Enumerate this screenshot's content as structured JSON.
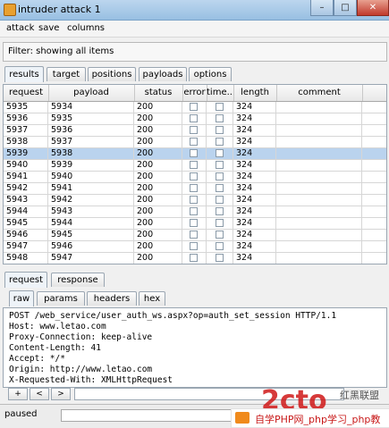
{
  "window": {
    "title": "intruder attack 1"
  },
  "menu": [
    "attack",
    "save",
    "columns"
  ],
  "filter": {
    "text": "Filter: showing all items"
  },
  "results_tabs": [
    "results",
    "target",
    "positions",
    "payloads",
    "options"
  ],
  "table": {
    "columns": [
      "request",
      "payload",
      "status",
      "error",
      "time...",
      "length",
      "comment"
    ],
    "rows": [
      {
        "request": "5935",
        "payload": "5934",
        "status": "200",
        "length": "324",
        "comment": ""
      },
      {
        "request": "5936",
        "payload": "5935",
        "status": "200",
        "length": "324",
        "comment": ""
      },
      {
        "request": "5937",
        "payload": "5936",
        "status": "200",
        "length": "324",
        "comment": ""
      },
      {
        "request": "5938",
        "payload": "5937",
        "status": "200",
        "length": "324",
        "comment": ""
      },
      {
        "request": "5939",
        "payload": "5938",
        "status": "200",
        "length": "324",
        "comment": "",
        "selected": true
      },
      {
        "request": "5940",
        "payload": "5939",
        "status": "200",
        "length": "324",
        "comment": ""
      },
      {
        "request": "5941",
        "payload": "5940",
        "status": "200",
        "length": "324",
        "comment": ""
      },
      {
        "request": "5942",
        "payload": "5941",
        "status": "200",
        "length": "324",
        "comment": ""
      },
      {
        "request": "5943",
        "payload": "5942",
        "status": "200",
        "length": "324",
        "comment": ""
      },
      {
        "request": "5944",
        "payload": "5943",
        "status": "200",
        "length": "324",
        "comment": ""
      },
      {
        "request": "5945",
        "payload": "5944",
        "status": "200",
        "length": "324",
        "comment": ""
      },
      {
        "request": "5946",
        "payload": "5945",
        "status": "200",
        "length": "324",
        "comment": ""
      },
      {
        "request": "5947",
        "payload": "5946",
        "status": "200",
        "length": "324",
        "comment": ""
      },
      {
        "request": "5948",
        "payload": "5947",
        "status": "200",
        "length": "324",
        "comment": ""
      }
    ]
  },
  "detail_tabs": [
    "request",
    "response"
  ],
  "view_tabs": [
    "raw",
    "params",
    "headers",
    "hex"
  ],
  "request_lines": [
    "POST /web_service/user_auth_ws.aspx?op=auth_set_session HTTP/1.1",
    "Host: www.letao.com",
    "Proxy-Connection: keep-alive",
    "Content-Length: 41",
    "Accept: */*",
    "Origin: http://www.letao.com",
    "X-Requested-With: XMLHttpRequest"
  ],
  "search_buttons": [
    "+",
    "<",
    ">"
  ],
  "status": {
    "text": "paused"
  },
  "watermark": {
    "caption": "自学PHP网_php学习_php教"
  },
  "colors": {
    "selected_row": "#bad3ee",
    "titlebar": "#98bfe2"
  }
}
